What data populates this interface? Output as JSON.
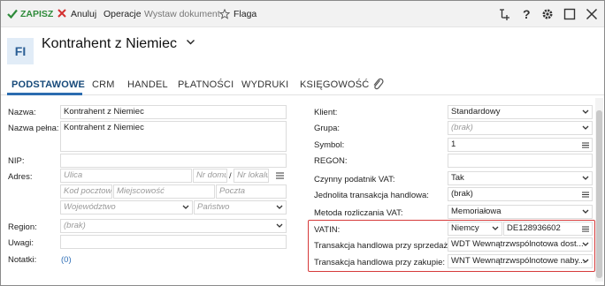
{
  "toolbar": {
    "save": "ZAPISZ",
    "cancel": "Anuluj",
    "operations": "Operacje",
    "issue_document": "Wystaw dokument",
    "flag": "Flaga",
    "save_color": "#2e8b3a",
    "cancel_color": "#d32f2f"
  },
  "header": {
    "avatar": "FI",
    "title": "Kontrahent z Niemiec"
  },
  "tabs": [
    "PODSTAWOWE",
    "CRM",
    "HANDEL",
    "PŁATNOŚCI",
    "WYDRUKI",
    "KSIĘGOWOŚĆ"
  ],
  "left": {
    "name_label": "Nazwa:",
    "name_value": "Kontrahent z Niemiec",
    "full_name_label": "Nazwa pełna:",
    "full_name_value": "Kontrahent z Niemiec",
    "nip_label": "NIP:",
    "address_label": "Adres:",
    "street_ph": "Ulica",
    "house_no_ph": "Nr domu",
    "slash": "/",
    "apt_no_ph": "Nr lokalu",
    "postal_ph": "Kod pocztowy",
    "city_ph": "Miejscowość",
    "post_ph": "Poczta",
    "province_ph": "Województwo",
    "country_ph": "Państwo",
    "region_label": "Region:",
    "region_value": "(brak)",
    "notes_label": "Uwagi:",
    "memos_label": "Notatki:",
    "memos_count": "(0)"
  },
  "right": {
    "client_label": "Klient:",
    "client_value": "Standardowy",
    "group_label": "Grupa:",
    "group_value": "(brak)",
    "symbol_label": "Symbol:",
    "symbol_value": "1",
    "regon_label": "REGON:",
    "vat_active_label": "Czynny podatnik VAT:",
    "vat_active_value": "Tak",
    "single_tx_label": "Jednolita transakcja handlowa:",
    "single_tx_value": "(brak)",
    "vat_method_label": "Metoda rozliczania VAT:",
    "vat_method_value": "Memoriałowa",
    "vatin_label": "VATIN:",
    "vatin_country": "Niemcy",
    "vatin_number": "DE128936602",
    "sale_tx_label": "Transakcja handlowa przy sprzedaży:",
    "sale_tx_value": "WDT Wewnątrzwspólnotowa dost...",
    "purchase_tx_label": "Transakcja handlowa przy zakupie:",
    "purchase_tx_value": "WNT Wewnątrzwspólnotowe naby..."
  },
  "icons": {
    "attachment": "paperclip-icon",
    "menu": "lines-icon",
    "dropdown": "chevron-down-icon"
  },
  "highlight_color": "#d63a3a"
}
